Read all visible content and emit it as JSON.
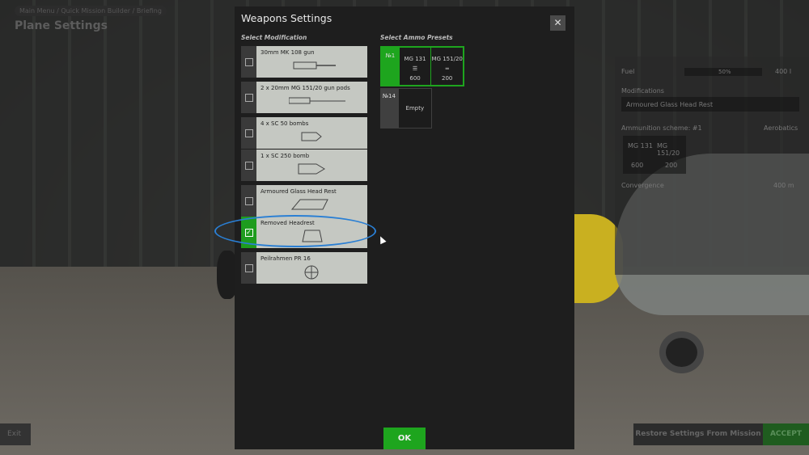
{
  "background": {
    "breadcrumb": "Main Menu / Quick Mission Builder / Briefing",
    "title": "Plane Settings",
    "side_panel": {
      "fuel_label": "Fuel",
      "fuel_percent": "50%",
      "fuel_value": "400 l",
      "modifications_label": "Modifications",
      "modification_value": "Armoured Glass Head Rest",
      "ammo_label": "Ammunition scheme: #1",
      "ammo_preset": "Aerobatics",
      "guns": [
        {
          "name": "MG 131",
          "count": "600"
        },
        {
          "name": "MG 151/20",
          "count": "200"
        }
      ],
      "convergence_label": "Convergence",
      "convergence_value": "400 m"
    },
    "exit": "Exit",
    "restore": "Restore Settings From Mission",
    "accept": "ACCEPT"
  },
  "modal": {
    "title": "Weapons Settings",
    "close_icon": "close-icon",
    "select_modification": "Select Modification",
    "select_ammo": "Select Ammo Presets",
    "modifications": [
      {
        "label": "30mm MK 108 gun",
        "checked": false
      },
      {
        "label": "2 x 20mm MG 151/20 gun pods",
        "checked": false
      },
      {
        "label": "4 x SC 50 bombs",
        "checked": false
      },
      {
        "label": "1 x SC 250 bomb",
        "checked": false
      },
      {
        "label": "Armoured Glass Head Rest",
        "checked": false
      },
      {
        "label": "Removed Headrest",
        "checked": true
      },
      {
        "label": "Peilrahmen PR 16",
        "checked": false
      }
    ],
    "presets": [
      {
        "number": "№1",
        "selected": true,
        "guns": [
          {
            "name": "MG 131",
            "count": "600"
          },
          {
            "name": "MG 151/20",
            "count": "200"
          }
        ]
      },
      {
        "number": "№14",
        "selected": false,
        "empty": "Empty"
      }
    ],
    "ok": "OK"
  },
  "colors": {
    "accent": "#1ea51e",
    "annotation": "#2a7fd4"
  }
}
